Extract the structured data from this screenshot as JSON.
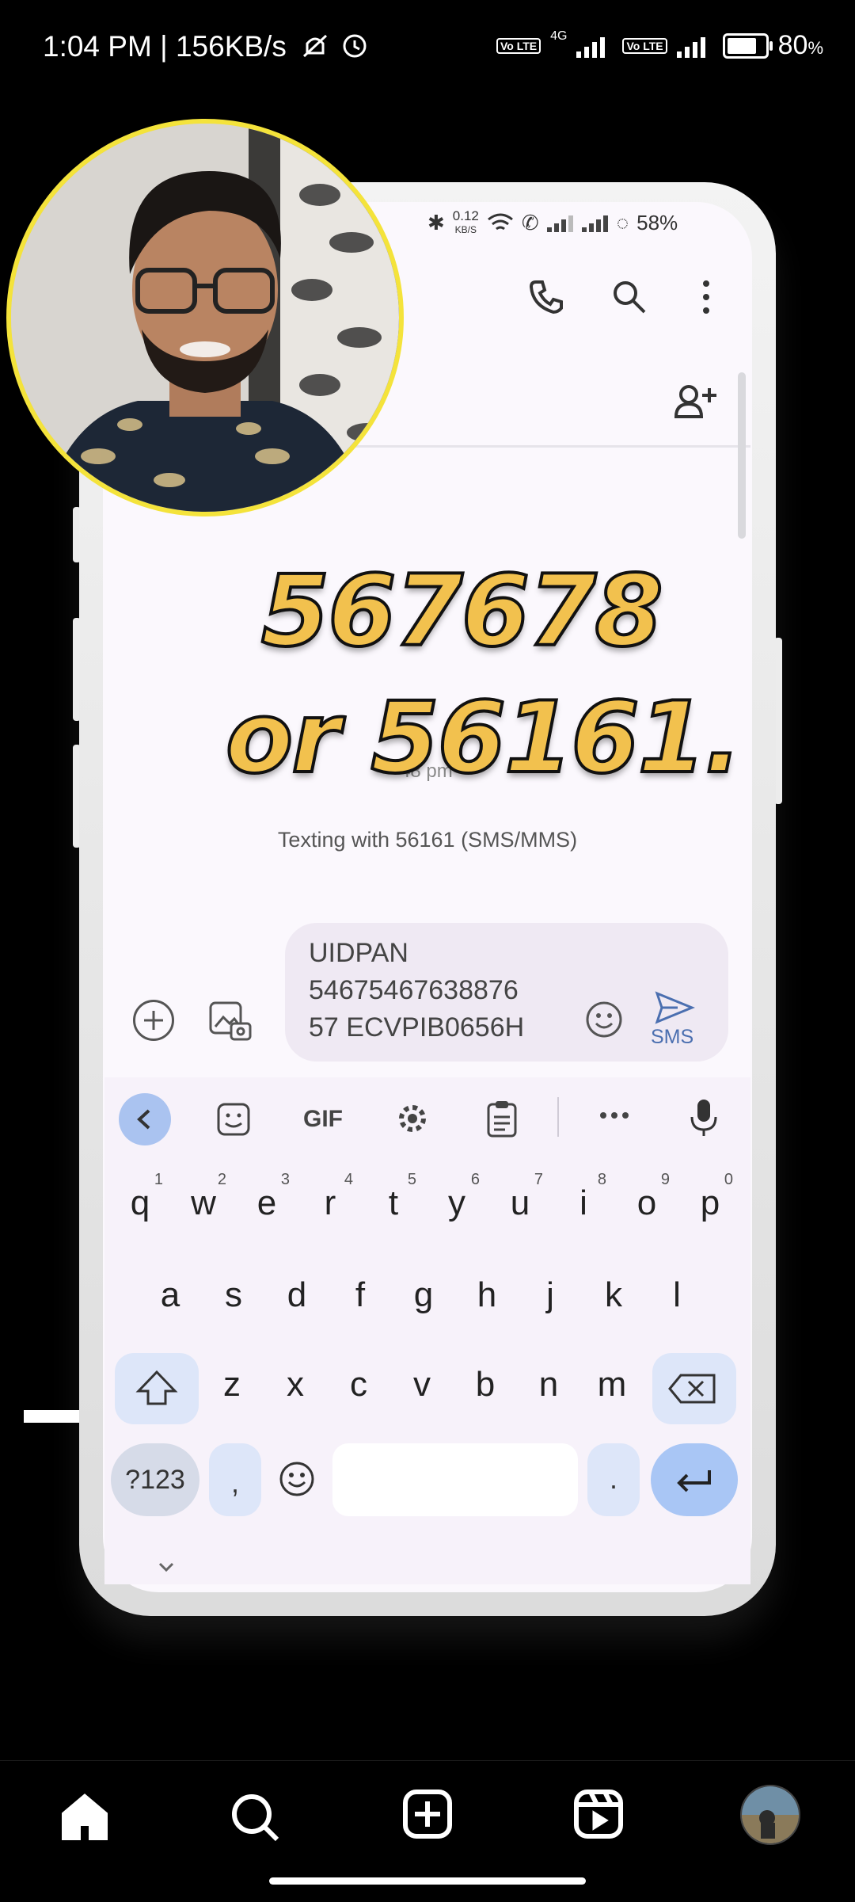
{
  "status_bar": {
    "left_text": "1:04 PM | 156KB/s",
    "network_gen": "4G",
    "volte_label": "Vo LTE",
    "battery_percent": "80",
    "battery_suffix": "%",
    "battery_level": 0.8
  },
  "video": {
    "inner_status": {
      "data_rate": "0.12",
      "data_unit": "KB/S",
      "battery": "58%"
    },
    "overlay_line1": "567678",
    "overlay_line2": "or 56161.",
    "timestamp_partial": "48 pm",
    "texting_with": "Texting with 56161 (SMS/MMS)",
    "message_lines": [
      "UIDPAN",
      "54675467638876",
      "57 ECVPIB0656H"
    ],
    "send_label": "SMS",
    "keyboard": {
      "toolbar_gif": "GIF",
      "row1": [
        {
          "k": "q",
          "n": "1"
        },
        {
          "k": "w",
          "n": "2"
        },
        {
          "k": "e",
          "n": "3"
        },
        {
          "k": "r",
          "n": "4"
        },
        {
          "k": "t",
          "n": "5"
        },
        {
          "k": "y",
          "n": "6"
        },
        {
          "k": "u",
          "n": "7"
        },
        {
          "k": "i",
          "n": "8"
        },
        {
          "k": "o",
          "n": "9"
        },
        {
          "k": "p",
          "n": "0"
        }
      ],
      "row2": [
        "a",
        "s",
        "d",
        "f",
        "g",
        "h",
        "j",
        "k",
        "l"
      ],
      "row3": [
        "z",
        "x",
        "c",
        "v",
        "b",
        "n",
        "m"
      ],
      "num_key": "?123",
      "comma_key": ",",
      "period_key": "."
    }
  },
  "bottom_nav": {
    "items": [
      "home-icon",
      "search-icon",
      "create-icon",
      "reels-icon",
      "profile-avatar"
    ]
  },
  "colors": {
    "overlay_text": "#f2c14e",
    "pip_border": "#f4e33b",
    "send_blue": "#4b6fb0",
    "enter_key": "#a9c6f5"
  }
}
